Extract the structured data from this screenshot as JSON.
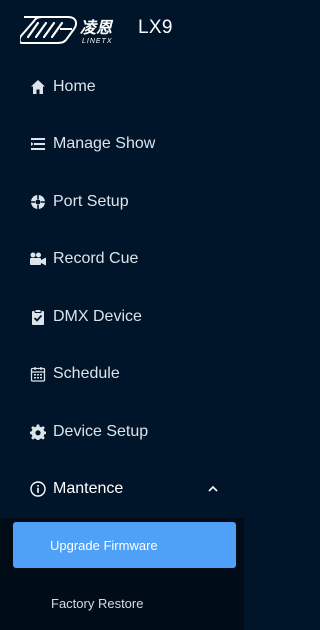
{
  "brand": {
    "logo_text": "凌恩",
    "logo_sub": "LINETX",
    "title": "LX9"
  },
  "menu": [
    {
      "key": "home",
      "label": "Home",
      "icon": "home-icon"
    },
    {
      "key": "manage-show",
      "label": "Manage Show",
      "icon": "list-icon"
    },
    {
      "key": "port-setup",
      "label": "Port Setup",
      "icon": "port-icon"
    },
    {
      "key": "record-cue",
      "label": "Record Cue",
      "icon": "camera-icon"
    },
    {
      "key": "dmx-device",
      "label": "DMX Device",
      "icon": "clipboard-icon"
    },
    {
      "key": "schedule",
      "label": "Schedule",
      "icon": "calendar-icon"
    },
    {
      "key": "device-setup",
      "label": "Device Setup",
      "icon": "gear-icon"
    },
    {
      "key": "mantence",
      "label": "Mantence",
      "icon": "info-icon",
      "expanded": true
    }
  ],
  "submenu": [
    {
      "label": "Upgrade Firmware",
      "active": true
    },
    {
      "label": "Factory Restore",
      "active": false
    }
  ],
  "colors": {
    "sidebar_bg": "#001529",
    "submenu_bg": "#000c17",
    "active_bg": "#4ea1f7",
    "text": "#dde3ea"
  }
}
